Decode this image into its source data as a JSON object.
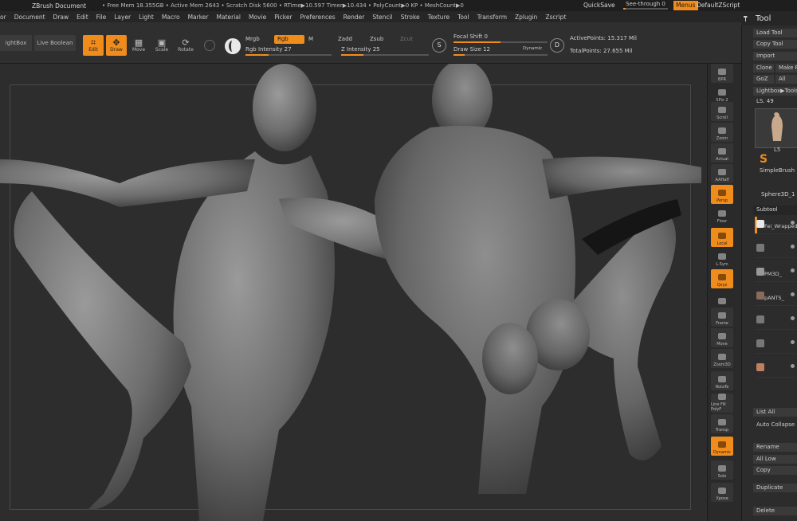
{
  "titlebar": {
    "doc": "ZBrush Document",
    "stats": "• Free Mem 18.355GB • Active Mem 2643 • Scratch Disk 5600 • RTime▶10.597 Timer▶10.434 • PolyCount▶0 KP • MeshCount▶0",
    "quicksave": "QuickSave",
    "seethrough": "See-through 0",
    "seethrough_value": 0,
    "menus": "Menus",
    "default_script": "DefaultZScript"
  },
  "menubar": [
    "or",
    "Document",
    "Draw",
    "Edit",
    "File",
    "Layer",
    "Light",
    "Macro",
    "Marker",
    "Material",
    "Movie",
    "Picker",
    "Preferences",
    "Render",
    "Stencil",
    "Stroke",
    "Texture",
    "Tool",
    "Transform",
    "Zplugin",
    "Zscript"
  ],
  "tool_header": "Tool",
  "shelf": {
    "lightbox": "ightBox",
    "live_boolean": "Live Boolean",
    "edit": "Edit",
    "draw": "Draw",
    "move": "Move",
    "scale": "Scale",
    "rotate": "Rotate",
    "mrgb": "Mrgb",
    "rgb": "Rgb",
    "m": "M",
    "rgb_intensity": "Rgb Intensity 27",
    "rgb_intensity_value": 27,
    "zadd": "Zadd",
    "zsub": "Zsub",
    "zcut": "Zcut",
    "z_intensity": "Z Intensity 25",
    "z_intensity_value": 25,
    "focal_shift": "Focal Shift 0",
    "focal_shift_value": 0,
    "draw_size": "Draw Size 12",
    "draw_size_value": 12,
    "dynamic": "Dynamic",
    "active_points": "ActivePoints: 15.317 Mil",
    "total_points": "TotalPoints: 27.655 Mil"
  },
  "right_shelf": [
    {
      "label": "BPR",
      "state": "off"
    },
    {
      "label": "SPix 2",
      "state": "plain"
    },
    {
      "label": "Scroll",
      "state": "off"
    },
    {
      "label": "Zoom",
      "state": "off"
    },
    {
      "label": "Actual",
      "state": "off"
    },
    {
      "label": "AAHalf",
      "state": "off"
    },
    {
      "label": "Persp",
      "state": "on"
    },
    {
      "label": "Floor",
      "state": "plain"
    },
    {
      "label": "Local",
      "state": "on"
    },
    {
      "label": "L.Sym",
      "state": "plain"
    },
    {
      "label": "Qxyz",
      "state": "on"
    },
    {
      "label": "",
      "state": "plain"
    },
    {
      "label": "Frame",
      "state": "off"
    },
    {
      "label": "Move",
      "state": "off"
    },
    {
      "label": "Zoom3D",
      "state": "off"
    },
    {
      "label": "RotaTe",
      "state": "off"
    },
    {
      "label": "Line Fill PolyF",
      "state": "off"
    },
    {
      "label": "Transp",
      "state": "off"
    },
    {
      "label": "Dynamic",
      "state": "on"
    },
    {
      "label": "Solo",
      "state": "off"
    },
    {
      "label": "Xpose",
      "state": "off"
    }
  ],
  "tool_panel": {
    "load_tool": "Load Tool",
    "copy_tool": "Copy Tool",
    "import": "Import",
    "clone": "Clone",
    "make": "Make P",
    "goz": "GoZ",
    "all": "All",
    "lightbox_tools": "Lightbox▶Tools",
    "ls": "LS. 49",
    "thumb_label": "L5",
    "simplebrush": "SimpleBrush",
    "sphere": "Sphere3D_1",
    "subtool": "Subtool",
    "subtools": [
      "Fei_Wrapped",
      "",
      "PM3D_",
      "pANTS_",
      "",
      "",
      ""
    ],
    "list_all": "List All",
    "auto_collapse": "Auto Collapse",
    "rename": "Rename",
    "all_low": "All Low",
    "copy": "Copy",
    "duplicate": "Duplicate",
    "delete": "Delete"
  },
  "colors": {
    "accent": "#f08c1c",
    "background": "#2d2d2d",
    "panel": "#2c2c2c"
  }
}
